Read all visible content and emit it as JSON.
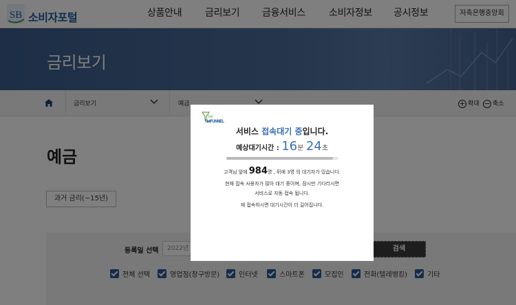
{
  "header": {
    "logo_mark": "SB",
    "logo_text": "소비자포털",
    "nav": [
      "상품안내",
      "금리보기",
      "금융서비스",
      "소비자정보",
      "공시정보"
    ],
    "button": "저축은행중앙회"
  },
  "banner": {
    "title": "금리보기"
  },
  "breadcrumb": {
    "items": [
      "금리보기",
      "예금"
    ],
    "zoom_in": "확대",
    "zoom_out": "축소"
  },
  "main": {
    "title": "예금",
    "past_rates_button": "과거 금리(~15년)",
    "search": {
      "label": "등록일 선택",
      "date_value": "2022년",
      "button": "검색",
      "checkboxes": [
        "전체 선택",
        "영업점(창구방문)",
        "인터넷",
        "스마트폰",
        "모집인",
        "전화(텔레뱅킹)",
        "기타"
      ]
    }
  },
  "modal": {
    "logo_text": "NetFUNNEL",
    "title_pre": "서비스 ",
    "title_hl": "접속대기 중",
    "title_post": "입니다.",
    "wait_label": "예상대기시간 : ",
    "wait_min": "16",
    "wait_min_unit": "분",
    "wait_sec": "24",
    "wait_sec_unit": "초",
    "progress": 0.95,
    "queue_pre": "고객님 앞에 ",
    "queue_ahead": "984",
    "queue_mid": "명 , 뒤에 3명 의 대기자가 있습니다.",
    "line2": "현재 접속 사용자가 많아 대기 중이며, 잠시만 기다리시면",
    "line3": "서비스로 자동 접속 됩니다.",
    "line4": "재 접속하시면 대기시간이 더 길어집니다."
  },
  "colors": {
    "accent": "#3a6fb5",
    "banner": "#4a6b99",
    "checkbox": "#2b5b99"
  }
}
